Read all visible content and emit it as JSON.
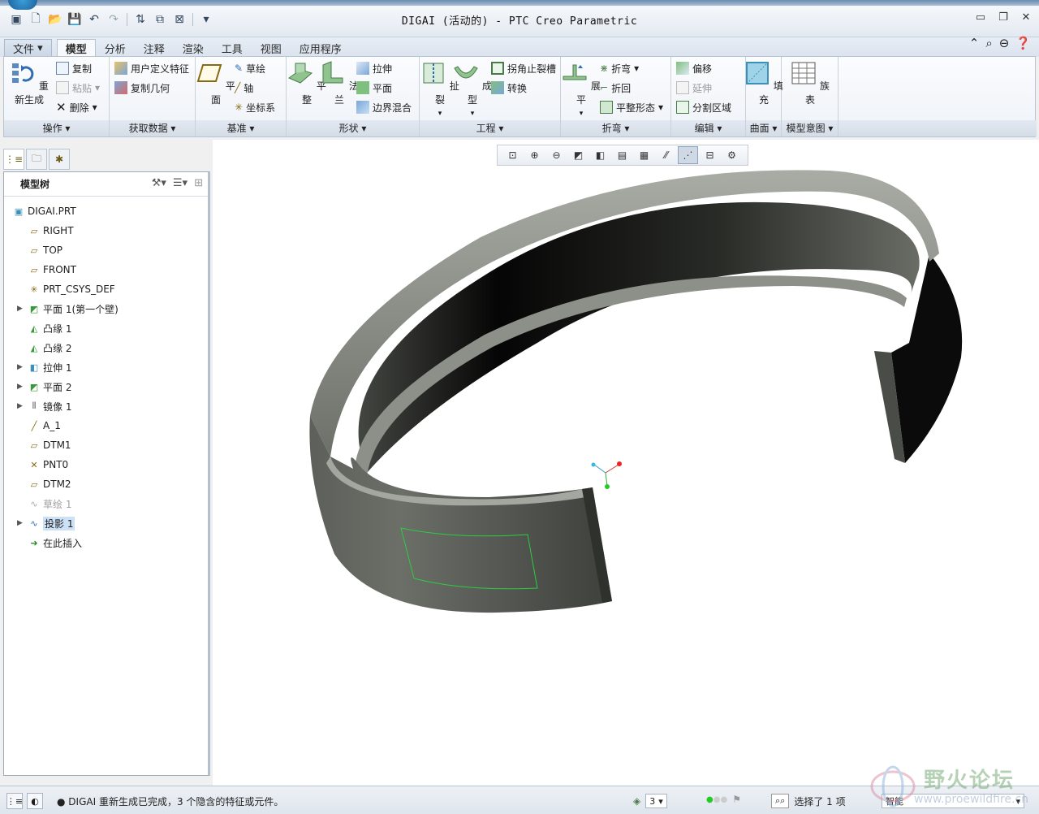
{
  "window": {
    "title": "DIGAI (活动的) - PTC Creo Parametric",
    "controls": [
      "▭",
      "❐",
      "✕"
    ]
  },
  "ribbon_tabs": [
    "文件",
    "模型",
    "分析",
    "注释",
    "渲染",
    "工具",
    "视图",
    "应用程序"
  ],
  "ribbon_groups": {
    "operations": {
      "label": "操作",
      "regenerate": "重新生成",
      "copy": "复制",
      "paste": "粘贴",
      "delete": "删除"
    },
    "get_data": {
      "label": "获取数据",
      "udf": "用户定义特征",
      "copy_geom": "复制几何"
    },
    "datum": {
      "label": "基准",
      "plane": "平面",
      "sketch": "草绘",
      "axis": "轴",
      "csys": "坐标系"
    },
    "shapes": {
      "label": "形状",
      "flat": "平整",
      "flange": "法兰",
      "extrude": "拉伸",
      "planar": "平面",
      "blend": "边界混合"
    },
    "engineering": {
      "label": "工程",
      "rip": "扯裂",
      "form": "成型",
      "corner_relief": "拐角止裂槽",
      "convert": "转换"
    },
    "bends": {
      "label": "折弯",
      "unbend": "展平",
      "bend": "折弯",
      "bend_back": "折回",
      "flat_pattern": "平整形态"
    },
    "editing": {
      "label": "编辑",
      "offset": "偏移",
      "extend": "延伸",
      "split": "分割区域"
    },
    "surfaces": {
      "label": "曲面",
      "fill": "填充"
    },
    "intent": {
      "label": "模型意图",
      "family_table": "族表"
    }
  },
  "model_tree": {
    "title": "模型树",
    "items": [
      {
        "label": "DIGAI.PRT",
        "icon": "part-icon"
      },
      {
        "label": "RIGHT",
        "icon": "datum-plane-icon"
      },
      {
        "label": "TOP",
        "icon": "datum-plane-icon"
      },
      {
        "label": "FRONT",
        "icon": "datum-plane-icon"
      },
      {
        "label": "PRT_CSYS_DEF",
        "icon": "csys-icon"
      },
      {
        "label": "平面 1(第一个壁)",
        "icon": "wall-icon"
      },
      {
        "label": "凸缘 1",
        "icon": "flange-icon"
      },
      {
        "label": "凸缘 2",
        "icon": "flange-icon"
      },
      {
        "label": "拉伸 1",
        "icon": "extrude-icon"
      },
      {
        "label": "平面 2",
        "icon": "wall-icon"
      },
      {
        "label": "镜像 1",
        "icon": "mirror-icon"
      },
      {
        "label": "A_1",
        "icon": "axis-icon"
      },
      {
        "label": "DTM1",
        "icon": "datum-plane-icon"
      },
      {
        "label": "PNT0",
        "icon": "point-icon"
      },
      {
        "label": "DTM2",
        "icon": "datum-plane-icon"
      },
      {
        "label": "草绘 1",
        "icon": "sketch-icon"
      },
      {
        "label": "投影 1",
        "icon": "projection-icon"
      },
      {
        "label": "在此插入",
        "icon": "insert-arrow-icon"
      }
    ]
  },
  "status": {
    "message": "DIGAI 重新生成已完成，3 个隐含的特征或元件。",
    "layer_value": "3",
    "selection": "选择了 1 项",
    "filter": "智能"
  },
  "watermark": {
    "text": "野火论坛",
    "url": "www.proewildfire.cn"
  },
  "colors": {
    "accent": "#3a6ea5",
    "selection": "#cce0f6",
    "sketch_line": "#2ecc40"
  }
}
